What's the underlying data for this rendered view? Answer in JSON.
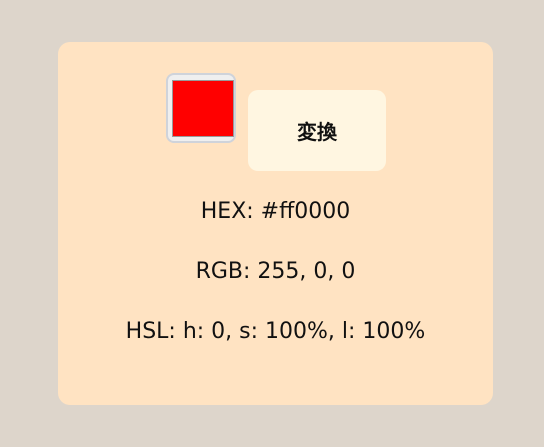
{
  "picker": {
    "color": "#ff0000"
  },
  "convert_button": {
    "label": "変換"
  },
  "results": {
    "hex": "HEX: #ff0000",
    "rgb": "RGB: 255, 0, 0",
    "hsl": "HSL: h: 0, s: 100%, l: 100%"
  },
  "colors": {
    "page_background": "#ddd5cb",
    "card_background": "#ffe3c2",
    "button_background": "#fff6e1"
  }
}
